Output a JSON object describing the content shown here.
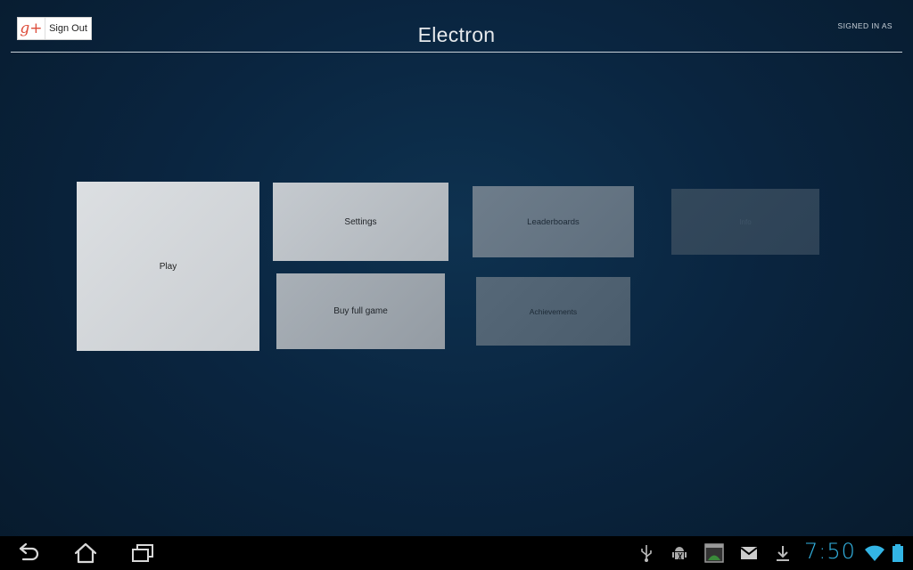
{
  "header": {
    "signout_label": "Sign Out",
    "gplus_glyph": "g+",
    "title": "Electron",
    "signed_in_label": "SIGNED IN AS"
  },
  "menu": {
    "play": "Play",
    "settings": "Settings",
    "buy_full_game": "Buy full game",
    "leaderboards": "Leaderboards",
    "achievements": "Achievements",
    "info": "Info"
  },
  "navbar": {
    "buttons": [
      "back-icon",
      "home-icon",
      "recent-apps-icon"
    ],
    "status_icons": [
      "usb-icon",
      "android-debug-icon",
      "screenshot-icon",
      "gmail-icon",
      "download-icon",
      "wifi-icon",
      "battery-icon"
    ],
    "clock": "7:50",
    "accent_color": "#33b5e5"
  },
  "colors": {
    "background": "#0a2540",
    "gplus_red": "#dd4b39"
  }
}
